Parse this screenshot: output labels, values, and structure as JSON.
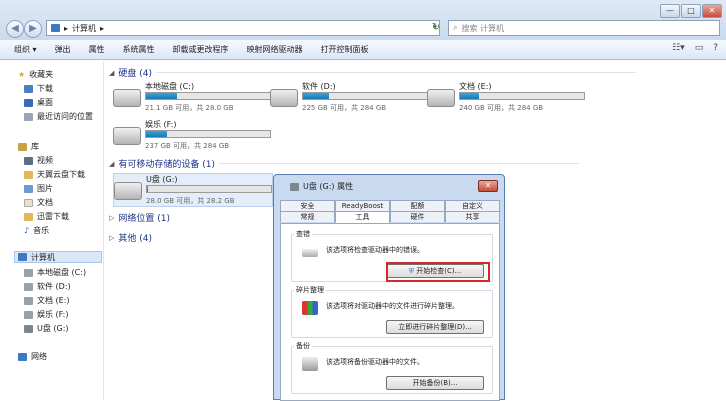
{
  "address": {
    "path": "计算机",
    "separator": "▸"
  },
  "search": {
    "placeholder": "搜索 计算机"
  },
  "toolbar": {
    "items": [
      "组织 ▾",
      "弹出",
      "属性",
      "系统属性",
      "卸载或更改程序",
      "映射网络驱动器",
      "打开控制面板"
    ]
  },
  "sidebar": {
    "favorites": "收藏夹",
    "fav_items": [
      "下载",
      "桌面",
      "最近访问的位置"
    ],
    "library": "库",
    "lib_items": [
      "视频",
      "天翼云盘下载",
      "图片",
      "文档",
      "迅雷下载",
      "音乐"
    ],
    "computer": "计算机",
    "comp_items": [
      "本地磁盘 (C:)",
      "软件 (D:)",
      "文档 (E:)",
      "娱乐 (F:)",
      "U盘 (G:)"
    ],
    "network": "网络"
  },
  "groups": {
    "hdd": "硬盘 (4)",
    "removable": "有可移动存储的设备 (1)",
    "netloc": "网络位置 (1)",
    "other": "其他 (4)"
  },
  "drives": [
    {
      "name": "本地磁盘 (C:)",
      "size": "21.1 GB 可用，共 28.0 GB",
      "used": 0.25
    },
    {
      "name": "软件 (D:)",
      "size": "225 GB 可用，共 284 GB",
      "used": 0.21
    },
    {
      "name": "文档 (E:)",
      "size": "240 GB 可用，共 284 GB",
      "used": 0.15
    },
    {
      "name": "娱乐 (F:)",
      "size": "237 GB 可用，共 284 GB",
      "used": 0.17
    },
    {
      "name": "U盘 (G:)",
      "size": "28.0 GB 可用，共 28.2 GB",
      "used": 0.01
    }
  ],
  "dialog": {
    "title": "U盘 (G:) 属性",
    "tabs_top": [
      "安全",
      "ReadyBoost",
      "配额",
      "自定义"
    ],
    "tabs_bottom": [
      "常规",
      "工具",
      "硬件",
      "共享"
    ],
    "sections": [
      {
        "label": "查错",
        "text": "该选项将检查驱动器中的错误。",
        "button": "开始检查(C)..."
      },
      {
        "label": "碎片整理",
        "text": "该选项将对驱动器中的文件进行碎片整理。",
        "button": "立即进行碎片整理(D)..."
      },
      {
        "label": "备份",
        "text": "该选项将备份驱动器中的文件。",
        "button": "开始备份(B)..."
      }
    ]
  },
  "window": {
    "minimize": "—",
    "maximize": "□",
    "close": "✕",
    "dialog_close": "✕"
  }
}
